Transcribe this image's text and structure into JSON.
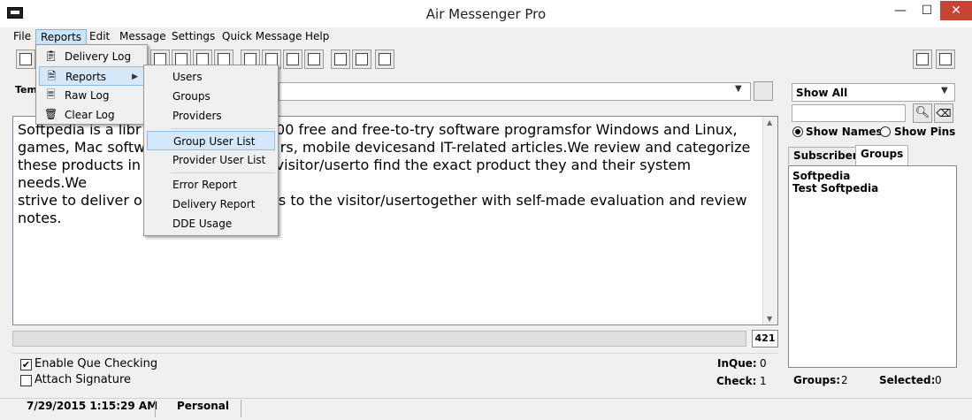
{
  "window": {
    "title": "Air Messenger Pro",
    "minimize": "—",
    "maximize": "☐",
    "close": "✕"
  },
  "menubar": {
    "file": "File",
    "reports": "Reports",
    "edit": "Edit",
    "message": "Message",
    "settings": "Settings",
    "quick_message": "Quick Message",
    "help": "Help"
  },
  "reports_menu": {
    "delivery_log": "Delivery Log",
    "reports": "Reports",
    "raw_log": "Raw Log",
    "clear_log": "Clear Log"
  },
  "reports_submenu": {
    "users": "Users",
    "groups": "Groups",
    "providers": "Providers",
    "group_user_list": "Group User List",
    "provider_user_list": "Provider User List",
    "error_report": "Error Report",
    "delivery_report": "Delivery Report",
    "dde_usage": "DDE Usage"
  },
  "template": {
    "label": "Tem"
  },
  "message": {
    "text": "Softpedia is a libr                              00 free and free-to-try software programsfor Windows and Linux,\ngames, Mac softw                              rs, mobile devicesand IT-related articles.We review and categorize\nthese products in                              visitor/userto find the exact product they and their system needs.We\nstrive to deliver or                             s to the visitor/usertogether with self-made evaluation and review\nnotes."
  },
  "counter": {
    "chars": "421"
  },
  "options": {
    "enable_que": "Enable Que Checking",
    "enable_que_checked": true,
    "attach_signature": "Attach Signature",
    "attach_signature_checked": false,
    "inque_label": "InQue:",
    "inque_value": "0",
    "check_label": "Check:",
    "check_value": "1"
  },
  "statusbar": {
    "datetime": "7/29/2015 1:15:29 AM",
    "profile": "Personal"
  },
  "right_panel": {
    "filter_value": "Show All",
    "show_names": "Show Names",
    "show_pins": "Show Pins",
    "tab_subscribers": "Subscribers",
    "tab_groups": "Groups",
    "groups": [
      "Softpedia",
      "Test Softpedia"
    ],
    "groups_label": "Groups:",
    "groups_count": "2",
    "selected_label": "Selected:",
    "selected_count": "0"
  },
  "colors": {
    "close_button": "#c74333",
    "menu_highlight": "#d5e8fa"
  }
}
